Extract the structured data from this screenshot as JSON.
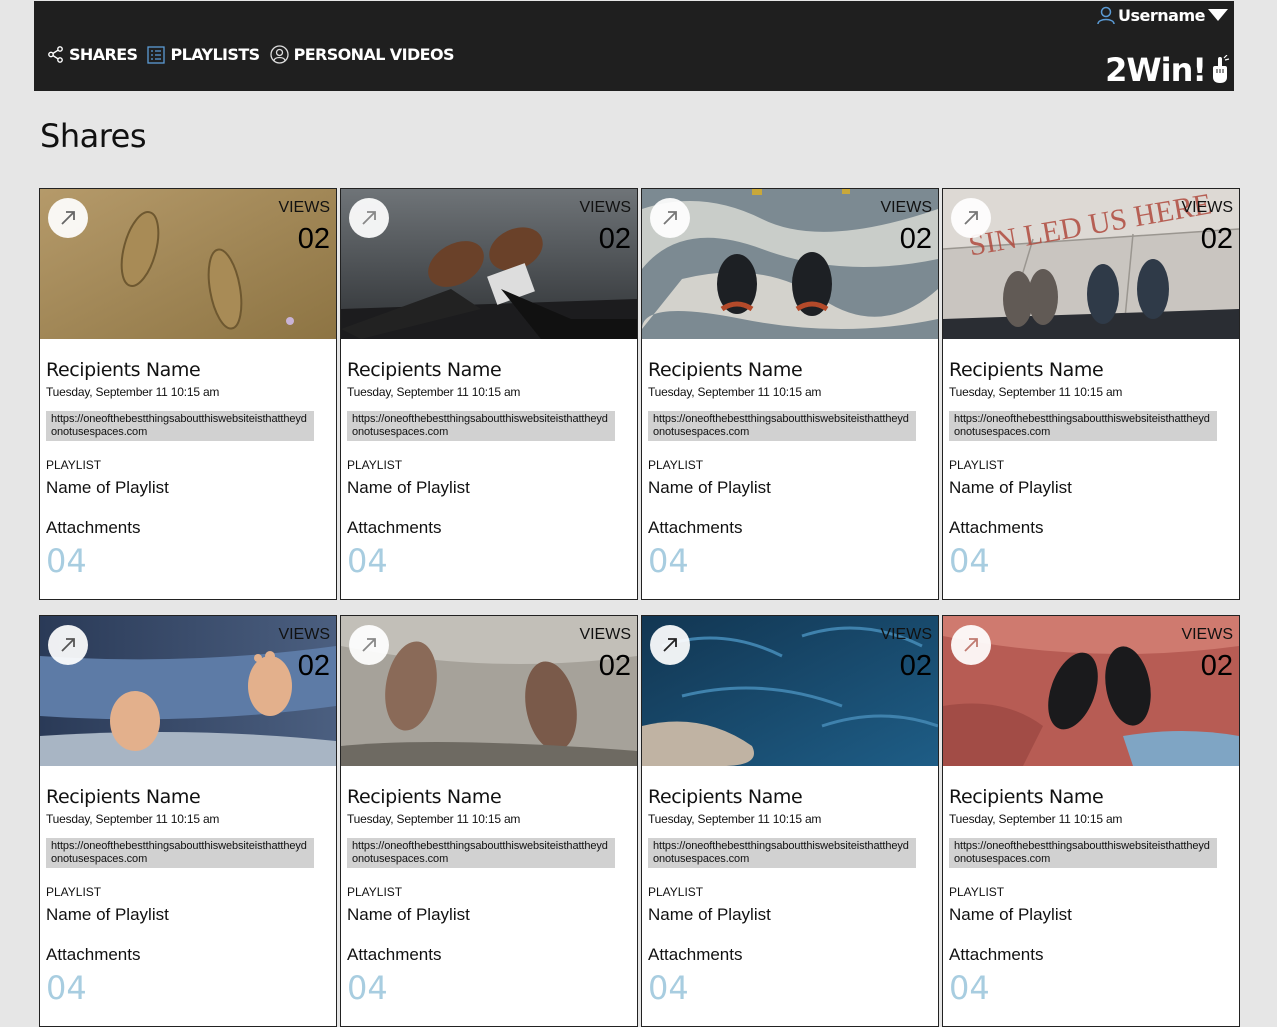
{
  "header": {
    "username": "Username",
    "brand": "2Win!",
    "nav": [
      {
        "label": "SHARES",
        "icon": "share-icon"
      },
      {
        "label": "PLAYLISTS",
        "icon": "list-icon"
      },
      {
        "label": "PERSONAL VIDEOS",
        "icon": "user-circle-icon"
      }
    ]
  },
  "page": {
    "title": "Shares"
  },
  "cards": [
    {
      "views_label": "VIEWS",
      "views": "02",
      "recipient": "Recipients Name",
      "date": "Tuesday, September 11 10:15 am",
      "url": "https://oneofthebestthingsaboutthiswebsiteisthattheydonotusespaces.com",
      "playlist_label": "PLAYLIST",
      "playlist": "Name of Playlist",
      "attachments_label": "Attachments",
      "attachments": "04",
      "image": "footprints-in-sand"
    },
    {
      "views_label": "VIEWS",
      "views": "02",
      "recipient": "Recipients Name",
      "date": "Tuesday, September 11 10:15 am",
      "url": "https://oneofthebestthingsaboutthiswebsiteisthattheydonotusespaces.com",
      "playlist_label": "PLAYLIST",
      "playlist": "Name of Playlist",
      "attachments_label": "Attachments",
      "attachments": "04",
      "image": "boots-by-water"
    },
    {
      "views_label": "VIEWS",
      "views": "02",
      "recipient": "Recipients Name",
      "date": "Tuesday, September 11 10:15 am",
      "url": "https://oneofthebestthingsaboutthiswebsiteisthattheydonotusespaces.com",
      "playlist_label": "PLAYLIST",
      "playlist": "Name of Playlist",
      "attachments_label": "Attachments",
      "attachments": "04",
      "image": "sneakers-on-pavement"
    },
    {
      "views_label": "VIEWS",
      "views": "02",
      "recipient": "Recipients Name",
      "date": "Tuesday, September 11 10:15 am",
      "url": "https://oneofthebestthingsaboutthiswebsiteisthattheydonotusespaces.com",
      "playlist_label": "PLAYLIST",
      "playlist": "Name of Playlist",
      "attachments_label": "Attachments",
      "attachments": "04",
      "image": "shoes-on-tiles"
    },
    {
      "views_label": "VIEWS",
      "views": "02",
      "recipient": "Recipients Name",
      "date": "Tuesday, September 11 10:15 am",
      "url": "https://oneofthebestthingsaboutthiswebsiteisthattheydonotusespaces.com",
      "playlist_label": "PLAYLIST",
      "playlist": "Name of Playlist",
      "attachments_label": "Attachments",
      "attachments": "04",
      "image": "baby-feet"
    },
    {
      "views_label": "VIEWS",
      "views": "02",
      "recipient": "Recipients Name",
      "date": "Tuesday, September 11 10:15 am",
      "url": "https://oneofthebestthingsaboutthiswebsiteisthattheydonotusespaces.com",
      "playlist_label": "PLAYLIST",
      "playlist": "Name of Playlist",
      "attachments_label": "Attachments",
      "attachments": "04",
      "image": "feet-in-shallow-water"
    },
    {
      "views_label": "VIEWS",
      "views": "02",
      "recipient": "Recipients Name",
      "date": "Tuesday, September 11 10:15 am",
      "url": "https://oneofthebestthingsaboutthiswebsiteisthattheydonotusespaces.com",
      "playlist_label": "PLAYLIST",
      "playlist": "Name of Playlist",
      "attachments_label": "Attachments",
      "attachments": "04",
      "image": "hand-in-blue-water"
    },
    {
      "views_label": "VIEWS",
      "views": "02",
      "recipient": "Recipients Name",
      "date": "Tuesday, September 11 10:15 am",
      "url": "https://oneofthebestthingsaboutthiswebsiteisthattheydonotusespaces.com",
      "playlist_label": "PLAYLIST",
      "playlist": "Name of Playlist",
      "attachments_label": "Attachments",
      "attachments": "04",
      "image": "sneakers-on-red-rock"
    }
  ],
  "colors": {
    "topbar": "#1f1f1f",
    "page_bg": "#e6e6e6",
    "attachments_count": "#a8cde0",
    "url_bg": "#d1d1d1"
  }
}
